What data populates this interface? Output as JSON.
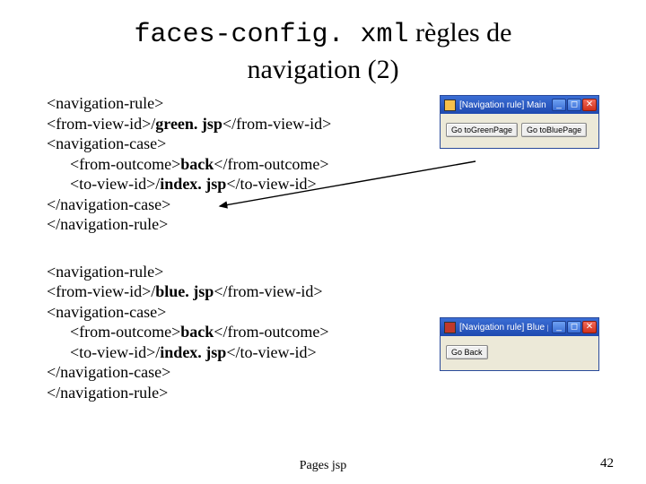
{
  "title": {
    "code": "faces-config. xml",
    "rest_line1": " règles de",
    "line2": "navigation (2)"
  },
  "rules": [
    {
      "open": "<navigation-rule>",
      "from_view": {
        "pre": "<from-view-id>/",
        "bold": "green. jsp",
        "post": "</from-view-id>"
      },
      "case_open": "<navigation-case>",
      "from_outcome": {
        "pre": "<from-outcome>",
        "bold": "back",
        "post": "</from-outcome>"
      },
      "to_view": {
        "pre": "<to-view-id>/",
        "bold": "index. jsp",
        "post": "</to-view-id>"
      },
      "case_close": "</navigation-case>",
      "close": "</navigation-rule>"
    },
    {
      "open": "<navigation-rule>",
      "from_view": {
        "pre": "<from-view-id>/",
        "bold": "blue. jsp",
        "post": "</from-view-id>"
      },
      "case_open": "<navigation-case>",
      "from_outcome": {
        "pre": "<from-outcome>",
        "bold": "back",
        "post": "</from-outcome>"
      },
      "to_view": {
        "pre": "<to-view-id>/",
        "bold": "index. jsp",
        "post": "</to-view-id>"
      },
      "case_close": "</navigation-case>",
      "close": "</navigation-rule>"
    }
  ],
  "windows": [
    {
      "title": "[Navigation rule] Main page…",
      "buttons": [
        "Go toGreenPage",
        "Go toBluePage"
      ],
      "icon": "yellow"
    },
    {
      "title": "[Navigation rule] Blue page …",
      "buttons": [
        "Go Back"
      ],
      "icon": "red"
    }
  ],
  "winbtn": {
    "min": "_",
    "max": "◻",
    "close": "✕"
  },
  "footer": "Pages jsp",
  "page": "42"
}
